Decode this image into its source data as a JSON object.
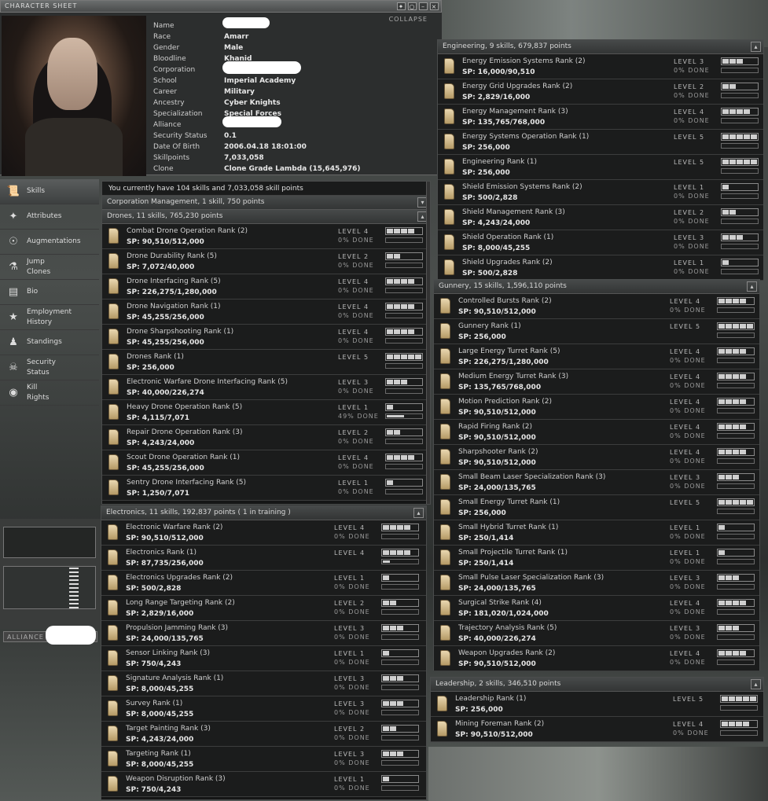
{
  "window": {
    "title": "CHARACTER SHEET",
    "collapse_label": "COLLAPSE"
  },
  "character": [
    {
      "k": "Name",
      "v": ""
    },
    {
      "k": "Race",
      "v": "Amarr"
    },
    {
      "k": "Gender",
      "v": "Male"
    },
    {
      "k": "Bloodline",
      "v": "Khanid"
    },
    {
      "k": "Corporation",
      "v": ""
    },
    {
      "k": "School",
      "v": "Imperial Academy"
    },
    {
      "k": "Career",
      "v": "Military"
    },
    {
      "k": "Ancestry",
      "v": "Cyber Knights"
    },
    {
      "k": "Specialization",
      "v": "Special Forces"
    },
    {
      "k": "Alliance",
      "v": ""
    },
    {
      "k": "Security Status",
      "v": "0.1"
    },
    {
      "k": "Date Of Birth",
      "v": "2006.04.18 18:01:00"
    },
    {
      "k": "Skillpoints",
      "v": "7,033,058"
    },
    {
      "k": "Clone",
      "v": "Clone Grade Lambda (15,645,976)"
    }
  ],
  "nav": [
    {
      "id": "skills",
      "label": "Skills",
      "icon": "book-icon",
      "glyph": "📜",
      "active": true
    },
    {
      "id": "attributes",
      "label": "Attributes",
      "icon": "attributes-icon",
      "glyph": "✦"
    },
    {
      "id": "augmentations",
      "label": "Augmentations",
      "icon": "implant-icon",
      "glyph": "☉"
    },
    {
      "id": "jump-clones",
      "label": "Jump\nClones",
      "icon": "clone-icon",
      "glyph": "⚗"
    },
    {
      "id": "bio",
      "label": "Bio",
      "icon": "bio-icon",
      "glyph": "▤"
    },
    {
      "id": "employment",
      "label": "Employment\nHistory",
      "icon": "employment-icon",
      "glyph": "★"
    },
    {
      "id": "standings",
      "label": "Standings",
      "icon": "standings-icon",
      "glyph": "♟"
    },
    {
      "id": "security",
      "label": "Security\nStatus",
      "icon": "skull-icon",
      "glyph": "☠"
    },
    {
      "id": "kill-rights",
      "label": "Kill\nRights",
      "icon": "target-icon",
      "glyph": "◉"
    }
  ],
  "alliance_tab": "ALLIANCE",
  "left_summary": "You currently have 104 skills and 7,033,058 skill points",
  "left_groups": [
    {
      "title": "Corporation Management, 1 skill, 750 points",
      "toggle": "▾",
      "skills": []
    },
    {
      "title": "Drones, 11 skills, 765,230 points",
      "toggle": "▴",
      "skills": [
        {
          "name": "Combat Drone Operation Rank (2)",
          "sp": "SP: 90,510/512,000",
          "level": "LEVEL 4",
          "done": "0% DONE",
          "lvl": 4,
          "pct": 0
        },
        {
          "name": "Drone Durability Rank (5)",
          "sp": "SP: 7,072/40,000",
          "level": "LEVEL 2",
          "done": "0% DONE",
          "lvl": 2,
          "pct": 0
        },
        {
          "name": "Drone Interfacing Rank (5)",
          "sp": "SP: 226,275/1,280,000",
          "level": "LEVEL 4",
          "done": "0% DONE",
          "lvl": 4,
          "pct": 0
        },
        {
          "name": "Drone Navigation Rank (1)",
          "sp": "SP: 45,255/256,000",
          "level": "LEVEL 4",
          "done": "0% DONE",
          "lvl": 4,
          "pct": 0
        },
        {
          "name": "Drone Sharpshooting Rank (1)",
          "sp": "SP: 45,255/256,000",
          "level": "LEVEL 4",
          "done": "0% DONE",
          "lvl": 4,
          "pct": 0
        },
        {
          "name": "Drones Rank (1)",
          "sp": "SP: 256,000",
          "level": "LEVEL 5",
          "done": "",
          "lvl": 5,
          "pct": 0
        },
        {
          "name": "Electronic Warfare Drone Interfacing Rank (5)",
          "sp": "SP: 40,000/226,274",
          "level": "LEVEL 3",
          "done": "0% DONE",
          "lvl": 3,
          "pct": 0
        },
        {
          "name": "Heavy Drone Operation Rank (5)",
          "sp": "SP: 4,115/7,071",
          "level": "LEVEL 1",
          "done": "49% DONE",
          "lvl": 1,
          "pct": 49
        },
        {
          "name": "Repair Drone Operation Rank (3)",
          "sp": "SP: 4,243/24,000",
          "level": "LEVEL 2",
          "done": "0% DONE",
          "lvl": 2,
          "pct": 0
        },
        {
          "name": "Scout Drone Operation Rank (1)",
          "sp": "SP: 45,255/256,000",
          "level": "LEVEL 4",
          "done": "0% DONE",
          "lvl": 4,
          "pct": 0
        },
        {
          "name": "Sentry Drone Interfacing Rank (5)",
          "sp": "SP: 1,250/7,071",
          "level": "LEVEL 1",
          "done": "0% DONE",
          "lvl": 1,
          "pct": 0
        }
      ]
    }
  ],
  "electronics": {
    "title": "Electronics, 11 skills, 192,837 points ( 1 in training )",
    "toggle": "▴",
    "skills": [
      {
        "name": "Electronic Warfare Rank (2)",
        "sp": "SP: 90,510/512,000",
        "level": "LEVEL 4",
        "done": "0% DONE",
        "lvl": 4,
        "pct": 0
      },
      {
        "name": "Electronics Rank (1)",
        "sp": "SP: 87,735/256,000",
        "level": "LEVEL 4",
        "done": "",
        "lvl": 4,
        "pct": 20
      },
      {
        "name": "Electronics Upgrades Rank (2)",
        "sp": "SP: 500/2,828",
        "level": "LEVEL 1",
        "done": "0% DONE",
        "lvl": 1,
        "pct": 0
      },
      {
        "name": "Long Range Targeting Rank (2)",
        "sp": "SP: 2,829/16,000",
        "level": "LEVEL 2",
        "done": "0% DONE",
        "lvl": 2,
        "pct": 0
      },
      {
        "name": "Propulsion Jamming Rank (3)",
        "sp": "SP: 24,000/135,765",
        "level": "LEVEL 3",
        "done": "0% DONE",
        "lvl": 3,
        "pct": 0
      },
      {
        "name": "Sensor Linking Rank (3)",
        "sp": "SP: 750/4,243",
        "level": "LEVEL 1",
        "done": "0% DONE",
        "lvl": 1,
        "pct": 0
      },
      {
        "name": "Signature Analysis Rank (1)",
        "sp": "SP: 8,000/45,255",
        "level": "LEVEL 3",
        "done": "0% DONE",
        "lvl": 3,
        "pct": 0
      },
      {
        "name": "Survey Rank (1)",
        "sp": "SP: 8,000/45,255",
        "level": "LEVEL 3",
        "done": "0% DONE",
        "lvl": 3,
        "pct": 0
      },
      {
        "name": "Target Painting Rank (3)",
        "sp": "SP: 4,243/24,000",
        "level": "LEVEL 2",
        "done": "0% DONE",
        "lvl": 2,
        "pct": 0
      },
      {
        "name": "Targeting Rank (1)",
        "sp": "SP: 8,000/45,255",
        "level": "LEVEL 3",
        "done": "0% DONE",
        "lvl": 3,
        "pct": 0
      },
      {
        "name": "Weapon Disruption Rank (3)",
        "sp": "SP: 750/4,243",
        "level": "LEVEL 1",
        "done": "0% DONE",
        "lvl": 1,
        "pct": 0
      }
    ]
  },
  "engineering": {
    "title": "Engineering, 9 skills, 679,837 points",
    "toggle": "▴",
    "skills": [
      {
        "name": "Energy Emission Systems Rank (2)",
        "sp": "SP: 16,000/90,510",
        "level": "LEVEL 3",
        "done": "0% DONE",
        "lvl": 3,
        "pct": 0
      },
      {
        "name": "Energy Grid Upgrades Rank (2)",
        "sp": "SP: 2,829/16,000",
        "level": "LEVEL 2",
        "done": "0% DONE",
        "lvl": 2,
        "pct": 0
      },
      {
        "name": "Energy Management Rank (3)",
        "sp": "SP: 135,765/768,000",
        "level": "LEVEL 4",
        "done": "0% DONE",
        "lvl": 4,
        "pct": 0
      },
      {
        "name": "Energy Systems Operation Rank (1)",
        "sp": "SP: 256,000",
        "level": "LEVEL 5",
        "done": "",
        "lvl": 5,
        "pct": 0
      },
      {
        "name": "Engineering Rank (1)",
        "sp": "SP: 256,000",
        "level": "LEVEL 5",
        "done": "",
        "lvl": 5,
        "pct": 0
      },
      {
        "name": "Shield Emission Systems Rank (2)",
        "sp": "SP: 500/2,828",
        "level": "LEVEL 1",
        "done": "0% DONE",
        "lvl": 1,
        "pct": 0
      },
      {
        "name": "Shield Management Rank (3)",
        "sp": "SP: 4,243/24,000",
        "level": "LEVEL 2",
        "done": "0% DONE",
        "lvl": 2,
        "pct": 0
      },
      {
        "name": "Shield Operation Rank (1)",
        "sp": "SP: 8,000/45,255",
        "level": "LEVEL 3",
        "done": "0% DONE",
        "lvl": 3,
        "pct": 0
      },
      {
        "name": "Shield Upgrades Rank (2)",
        "sp": "SP: 500/2,828",
        "level": "LEVEL 1",
        "done": "0% DONE",
        "lvl": 1,
        "pct": 0
      }
    ]
  },
  "gunnery": {
    "title": "Gunnery, 15 skills, 1,596,110 points",
    "toggle": "▴",
    "skills": [
      {
        "name": "Controlled Bursts Rank (2)",
        "sp": "SP: 90,510/512,000",
        "level": "LEVEL 4",
        "done": "0% DONE",
        "lvl": 4,
        "pct": 0
      },
      {
        "name": "Gunnery Rank (1)",
        "sp": "SP: 256,000",
        "level": "LEVEL 5",
        "done": "",
        "lvl": 5,
        "pct": 0
      },
      {
        "name": "Large Energy Turret Rank (5)",
        "sp": "SP: 226,275/1,280,000",
        "level": "LEVEL 4",
        "done": "0% DONE",
        "lvl": 4,
        "pct": 0
      },
      {
        "name": "Medium Energy Turret Rank (3)",
        "sp": "SP: 135,765/768,000",
        "level": "LEVEL 4",
        "done": "0% DONE",
        "lvl": 4,
        "pct": 0
      },
      {
        "name": "Motion Prediction Rank (2)",
        "sp": "SP: 90,510/512,000",
        "level": "LEVEL 4",
        "done": "0% DONE",
        "lvl": 4,
        "pct": 0
      },
      {
        "name": "Rapid Firing Rank (2)",
        "sp": "SP: 90,510/512,000",
        "level": "LEVEL 4",
        "done": "0% DONE",
        "lvl": 4,
        "pct": 0
      },
      {
        "name": "Sharpshooter Rank (2)",
        "sp": "SP: 90,510/512,000",
        "level": "LEVEL 4",
        "done": "0% DONE",
        "lvl": 4,
        "pct": 0
      },
      {
        "name": "Small Beam Laser Specialization Rank (3)",
        "sp": "SP: 24,000/135,765",
        "level": "LEVEL 3",
        "done": "0% DONE",
        "lvl": 3,
        "pct": 0
      },
      {
        "name": "Small Energy Turret Rank (1)",
        "sp": "SP: 256,000",
        "level": "LEVEL 5",
        "done": "",
        "lvl": 5,
        "pct": 0
      },
      {
        "name": "Small Hybrid Turret Rank (1)",
        "sp": "SP: 250/1,414",
        "level": "LEVEL 1",
        "done": "0% DONE",
        "lvl": 1,
        "pct": 0
      },
      {
        "name": "Small Projectile Turret Rank (1)",
        "sp": "SP: 250/1,414",
        "level": "LEVEL 1",
        "done": "0% DONE",
        "lvl": 1,
        "pct": 0
      },
      {
        "name": "Small Pulse Laser Specialization Rank (3)",
        "sp": "SP: 24,000/135,765",
        "level": "LEVEL 3",
        "done": "0% DONE",
        "lvl": 3,
        "pct": 0
      },
      {
        "name": "Surgical Strike Rank (4)",
        "sp": "SP: 181,020/1,024,000",
        "level": "LEVEL 4",
        "done": "0% DONE",
        "lvl": 4,
        "pct": 0
      },
      {
        "name": "Trajectory Analysis Rank (5)",
        "sp": "SP: 40,000/226,274",
        "level": "LEVEL 3",
        "done": "0% DONE",
        "lvl": 3,
        "pct": 0
      },
      {
        "name": "Weapon Upgrades Rank (2)",
        "sp": "SP: 90,510/512,000",
        "level": "LEVEL 4",
        "done": "0% DONE",
        "lvl": 4,
        "pct": 0
      }
    ]
  },
  "leadership": {
    "title": "Leadership, 2 skills, 346,510 points",
    "toggle": "▴",
    "skills": [
      {
        "name": "Leadership Rank (1)",
        "sp": "SP: 256,000",
        "level": "LEVEL 5",
        "done": "",
        "lvl": 5,
        "pct": 0
      },
      {
        "name": "Mining Foreman Rank (2)",
        "sp": "SP: 90,510/512,000",
        "level": "LEVEL 4",
        "done": "0% DONE",
        "lvl": 4,
        "pct": 0
      }
    ]
  }
}
